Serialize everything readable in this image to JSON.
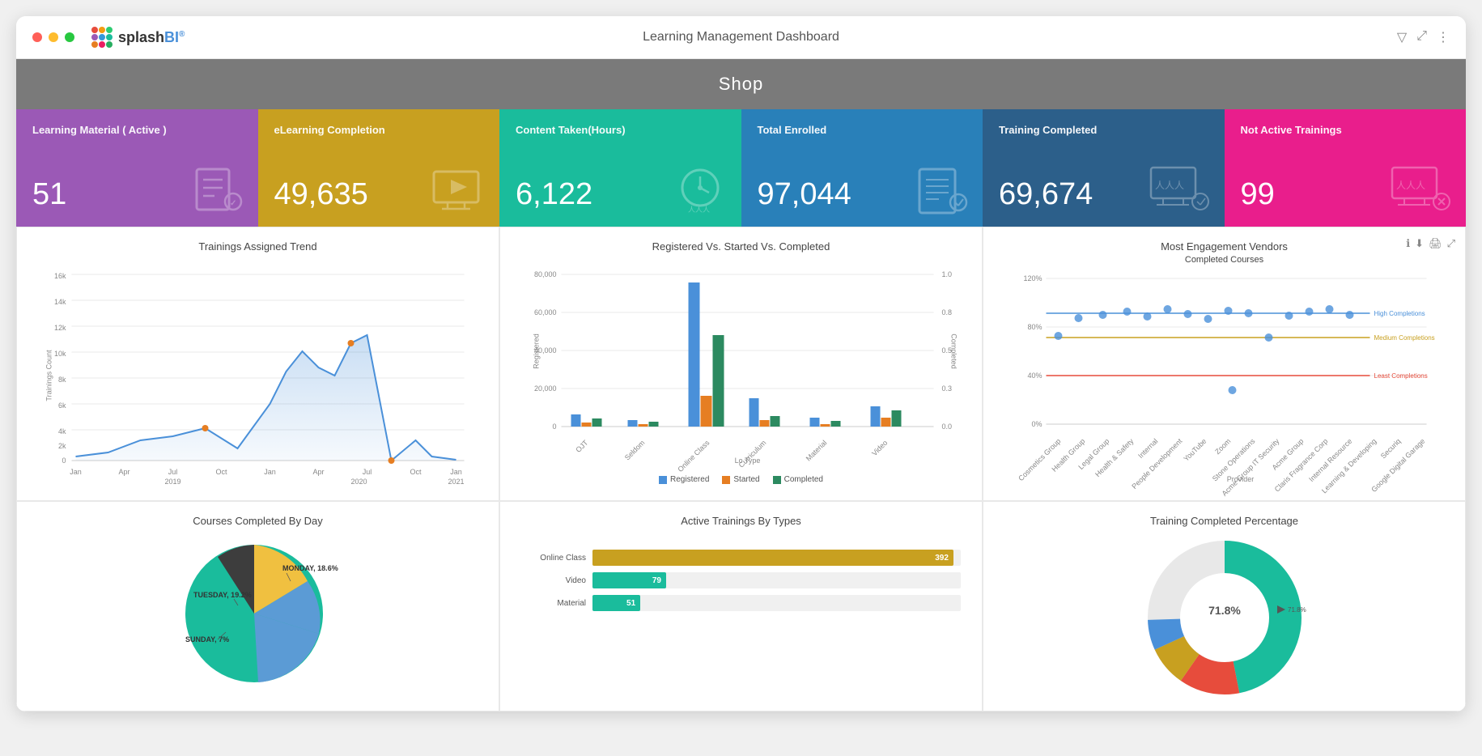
{
  "window": {
    "title": "Learning Management Dashboard"
  },
  "shop_header": "Shop",
  "kpi_tiles": [
    {
      "id": "learning-material",
      "label": "Learning Material ( Active )",
      "value": "51",
      "color": "tile-purple",
      "icon": "📚"
    },
    {
      "id": "elearning",
      "label": "eLearning Completion",
      "value": "49,635",
      "color": "tile-gold",
      "icon": "🖥"
    },
    {
      "id": "content-taken",
      "label": "Content Taken(Hours)",
      "value": "6,122",
      "color": "tile-teal",
      "icon": "⏱"
    },
    {
      "id": "total-enrolled",
      "label": "Total Enrolled",
      "value": "97,044",
      "color": "tile-cyan",
      "icon": "📋"
    },
    {
      "id": "training-completed",
      "label": "Training Completed",
      "value": "69,674",
      "color": "tile-blue",
      "icon": "🎓"
    },
    {
      "id": "not-active",
      "label": "Not Active Trainings",
      "value": "99",
      "color": "tile-pink",
      "icon": "📊"
    }
  ],
  "charts": {
    "trainings_trend": {
      "title": "Trainings Assigned Trend",
      "y_label": "Trainings Count",
      "x_labels": [
        "Jan",
        "Apr",
        "Jul",
        "Oct",
        "Jan",
        "Apr",
        "Jul",
        "Oct",
        "Jan"
      ],
      "x_sublabels": [
        "2019",
        "",
        "",
        "",
        "2020",
        "",
        "",
        "",
        "2021"
      ]
    },
    "registered_vs": {
      "title": "Registered Vs. Started Vs. Completed",
      "x_label": "Lo Type",
      "y_label": "Registered",
      "y2_label": "Completed",
      "categories": [
        "OJT",
        "Seldom",
        "Online Class",
        "Curriculum",
        "Material",
        "Video"
      ],
      "legend": [
        "Registered",
        "Started",
        "Completed"
      ]
    },
    "engagement": {
      "title": "Most Engagement Vendors",
      "subtitle": "Completed Courses",
      "lines": [
        "High Completions",
        "Medium Completions",
        "Least Completions"
      ]
    },
    "courses_by_day": {
      "title": "Courses Completed By Day",
      "segments": [
        {
          "label": "MONDAY",
          "value": "18.6%",
          "color": "#f0c040"
        },
        {
          "label": "TUESDAY",
          "value": "19.2%",
          "color": "#5b9bd5"
        },
        {
          "label": "SUNDAY",
          "value": "7%",
          "color": "#70ad47"
        }
      ]
    },
    "active_trainings": {
      "title": "Active Trainings By Types",
      "bars": [
        {
          "label": "Online Class",
          "value": 392,
          "max": 400,
          "color": "#c8a020"
        },
        {
          "label": "Video",
          "value": 79,
          "max": 400,
          "color": "#1abc9c"
        },
        {
          "label": "Material",
          "value": 51,
          "max": 400,
          "color": "#1abc9c"
        }
      ]
    },
    "training_percentage": {
      "title": "Training Completed Percentage",
      "donut_value": "71.8%"
    }
  },
  "toolbar": {
    "filter_icon": "▼",
    "expand_icon": "⤢",
    "menu_icon": "⋮"
  }
}
